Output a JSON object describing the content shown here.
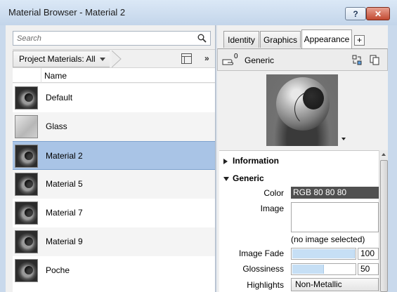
{
  "window": {
    "title": "Material Browser - Material 2",
    "help_label": "?",
    "close_label": "✕"
  },
  "search": {
    "placeholder": "Search"
  },
  "library_bar": {
    "breadcrumb": "Project Materials: All",
    "more_label": "»"
  },
  "list": {
    "column_name": "Name",
    "items": [
      {
        "name": "Default",
        "thumbnail": "sphere-icon",
        "selected": false
      },
      {
        "name": "Glass",
        "thumbnail": "glass-swatch",
        "selected": false
      },
      {
        "name": "Material 2",
        "thumbnail": "sphere-icon",
        "selected": true
      },
      {
        "name": "Material 5",
        "thumbnail": "sphere-icon",
        "selected": false
      },
      {
        "name": "Material 7",
        "thumbnail": "sphere-icon",
        "selected": false
      },
      {
        "name": "Material 9",
        "thumbnail": "sphere-icon",
        "selected": false
      },
      {
        "name": "Poche",
        "thumbnail": "sphere-icon",
        "selected": false
      }
    ]
  },
  "tabs": [
    {
      "label": "Identity",
      "active": false
    },
    {
      "label": "Graphics",
      "active": false
    },
    {
      "label": "Appearance",
      "active": true
    }
  ],
  "tab_add_label": "+",
  "asset": {
    "count": "0",
    "name": "Generic"
  },
  "properties": {
    "information_label": "Information",
    "generic_label": "Generic",
    "color_label": "Color",
    "color_value": "RGB 80 80 80",
    "image_label": "Image",
    "image_note": "(no image selected)",
    "image_fade_label": "Image Fade",
    "image_fade_value": "100",
    "image_fade_level": 1.0,
    "glossiness_label": "Glossiness",
    "glossiness_value": "50",
    "glossiness_level": 0.5,
    "highlights_label": "Highlights",
    "highlights_value": "Non-Metallic"
  },
  "colors": {
    "selection": "#a9c4e6",
    "color_swatch": "#505050",
    "slider_fill": "#c6dff5"
  }
}
